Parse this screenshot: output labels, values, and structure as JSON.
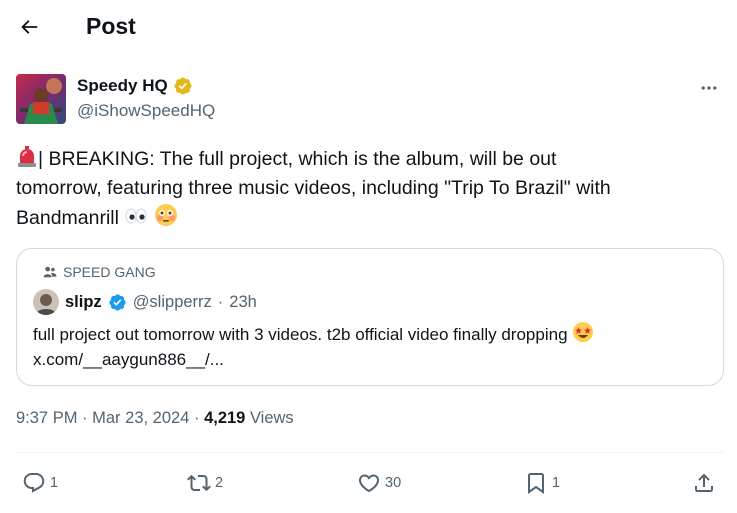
{
  "header": {
    "title": "Post",
    "back_icon": "arrow-left-icon"
  },
  "author": {
    "name": "Speedy HQ",
    "handle": "@iShowSpeedHQ",
    "verified_icon": "gold-verified-badge-icon",
    "more_icon": "more-horizontal-icon"
  },
  "post": {
    "line1": "| BREAKING: The full project, which is the album, will be out",
    "line2": "tomorrow, featuring three music videos, including \"Trip To Brazil\" with",
    "line3": "Bandmanrill",
    "emoji_siren": "siren-emoji",
    "emoji_eyes": "eyes-emoji",
    "emoji_flushed": "flushed-face-emoji"
  },
  "quote": {
    "social_context": "SPEED GANG",
    "author_name": "slipz",
    "author_handle": "@slipperrz",
    "separator": "·",
    "time": "23h",
    "text_line1": "full project out tomorrow with 3 videos. t2b official video finally dropping",
    "text_line2": "x.com/__aaygun886__/...",
    "emoji_star_struck": "star-struck-emoji"
  },
  "meta": {
    "time": "9:37 PM",
    "separator": "·",
    "date": "Mar 23, 2024",
    "views_count": "4,219",
    "views_label": "Views"
  },
  "actions": {
    "replies": "1",
    "reposts": "2",
    "likes": "30",
    "bookmarks": "1"
  },
  "colors": {
    "text_primary": "#0f1419",
    "text_secondary": "#536471",
    "border": "#cfd9de",
    "verified_gold": "#e2b719",
    "verified_blue": "#1d9bf0"
  }
}
